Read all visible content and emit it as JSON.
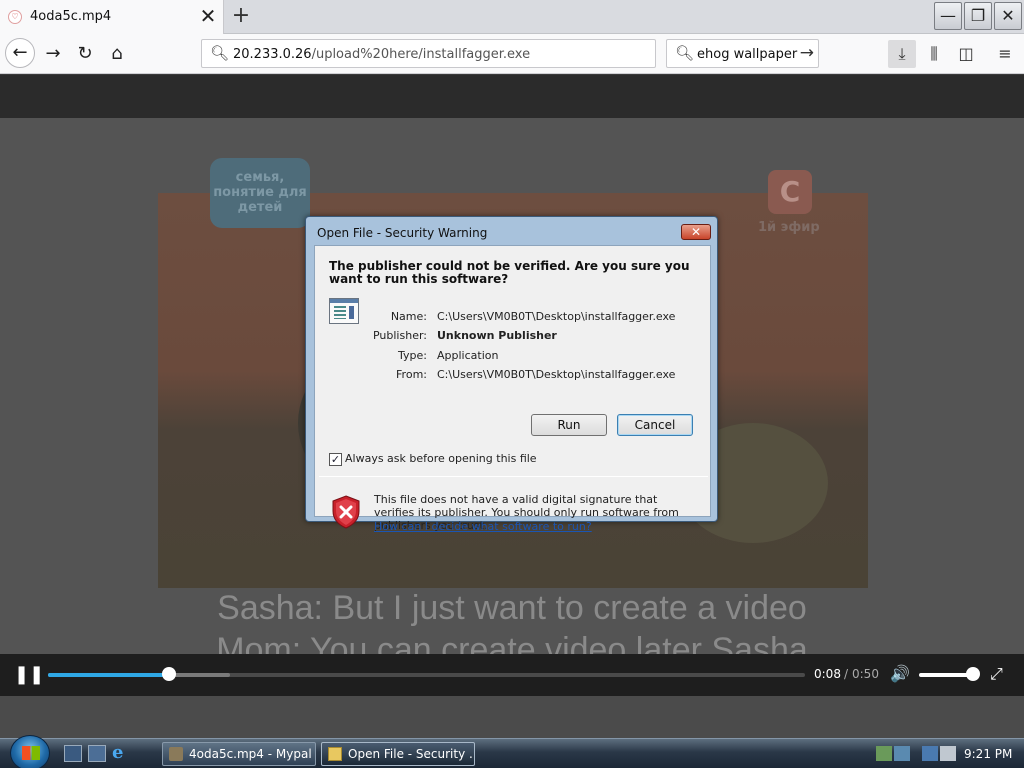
{
  "browser": {
    "tab": {
      "title": "4oda5c.mp4",
      "close": "✕"
    },
    "new_tab": "+",
    "window_buttons": {
      "minimize": "—",
      "restore": "❐",
      "close": "✕"
    },
    "nav": {
      "back": "←",
      "forward": "→",
      "reload": "↻",
      "home": "⌂"
    },
    "url": {
      "host": "20.233.0.26",
      "path": "/upload%20here/installfagger.exe"
    },
    "search": {
      "text": "ehog wallpaper",
      "go": "→"
    },
    "toolbar": {
      "download": "⤓",
      "library": "⫼",
      "sidebar": "◫",
      "menu": "≡"
    }
  },
  "video": {
    "logo_left": "семья, понятие для детей",
    "logo_right": "С",
    "logo_right_caption": "1й эфир",
    "subtitle_line1": "Sasha: But I just want to create a video",
    "subtitle_line2": "Mom: You can create video later Sasha"
  },
  "player": {
    "pause": "❚❚",
    "current_time": "0:08",
    "separator": "/",
    "duration": "0:50",
    "progress_fraction": 0.16,
    "buffered_fraction": 0.24,
    "volume_fraction": 0.9,
    "volume_icon": "🔊",
    "fullscreen_icon": "⤢"
  },
  "dialog": {
    "title": "Open File - Security Warning",
    "close": "✕",
    "heading": "The publisher could not be verified.  Are you sure you want to run this software?",
    "fields": [
      {
        "label": "Name:",
        "value": "C:\\Users\\VM0B0T\\Desktop\\installfagger.exe"
      },
      {
        "label": "Publisher:",
        "value": "Unknown Publisher"
      },
      {
        "label": "Type:",
        "value": "Application"
      },
      {
        "label": "From:",
        "value": "C:\\Users\\VM0B0T\\Desktop\\installfagger.exe"
      }
    ],
    "run_button": "Run",
    "cancel_button": "Cancel",
    "checkbox_label": "Always ask before opening this file",
    "checkbox_checked": true,
    "checkbox_mark": "✓",
    "warning_text": "This file does not have a valid digital signature that verifies its publisher.  You should only run software from publishers you trust.",
    "help_link": "How can I decide what software to run?"
  },
  "taskbar": {
    "tasks": [
      {
        "label": "4oda5c.mp4 - Mypal"
      },
      {
        "label": "Open File - Security ..."
      }
    ],
    "ie_icon": "e",
    "clock": "9:21 PM"
  }
}
